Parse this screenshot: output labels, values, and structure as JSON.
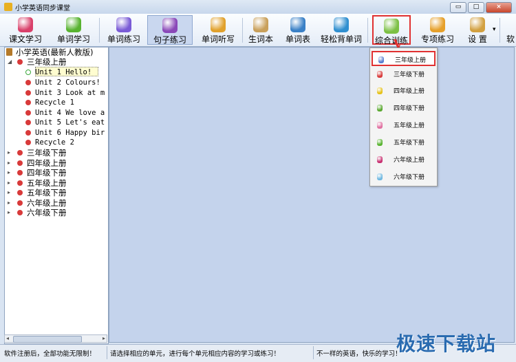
{
  "window": {
    "title": "小学英语同步课堂",
    "buttons": [
      "▭",
      "□",
      "×"
    ]
  },
  "toolbar": {
    "items": [
      {
        "label": "课文学习",
        "color": "#d9406a"
      },
      {
        "label": "单词学习",
        "color": "#58b330"
      },
      {
        "label": "单词练习",
        "color": "#7a5bd6"
      },
      {
        "label": "句子练习",
        "color": "#8a48b8"
      },
      {
        "label": "单词听写",
        "color": "#e1a12c"
      },
      {
        "label": "生词本",
        "color": "#c9a05a"
      },
      {
        "label": "单词表",
        "color": "#3a80c6"
      },
      {
        "label": "轻松背单词",
        "color": "#2f8fd0"
      },
      {
        "label": "综合训练",
        "color": "#7cc044"
      },
      {
        "label": "专项练习",
        "color": "#e6a02a"
      },
      {
        "label": "设  置",
        "color": "#d2a040"
      },
      {
        "label": "软"
      }
    ],
    "dropdown_arrow": "▾"
  },
  "tree": {
    "root": "小学英语(最新人教版)",
    "grade_expanded": "三年级上册",
    "units": [
      "Unit 1 Hello!",
      "Unit 2 Colours!",
      "Unit 3 Look at m",
      "Recycle 1",
      "Unit 4 We love a",
      "Unit 5 Let's eat",
      "Unit 6 Happy bir",
      "Recycle 2"
    ],
    "grades": [
      "三年级下册",
      "四年级上册",
      "四年级下册",
      "五年级上册",
      "五年级下册",
      "六年级上册",
      "六年级下册"
    ],
    "expand_glyph": "▸",
    "collapse_glyph": "◢",
    "scroll_left": "◂",
    "scroll_right": "▸"
  },
  "dropdown": {
    "items": [
      {
        "label": "三年级上册",
        "icon_color": "#5a7fd0"
      },
      {
        "label": "三年级下册",
        "icon_color": "#d83a3a"
      },
      {
        "label": "四年级上册",
        "icon_color": "#e6c21a"
      },
      {
        "label": "四年级下册",
        "icon_color": "#5aa830"
      },
      {
        "label": "五年级上册",
        "icon_color": "#e070a0"
      },
      {
        "label": "五年级下册",
        "icon_color": "#58b330"
      },
      {
        "label": "六年级上册",
        "icon_color": "#c83070"
      },
      {
        "label": "六年级下册",
        "icon_color": "#70b8e0"
      }
    ]
  },
  "status": {
    "left": "软件注册后，全部功能无限制！",
    "middle": "请选择相应的单元，进行每个单元相应内容的学习或练习！",
    "right": "不一样的英语，快乐的学习！"
  },
  "watermark": "极速下载站"
}
